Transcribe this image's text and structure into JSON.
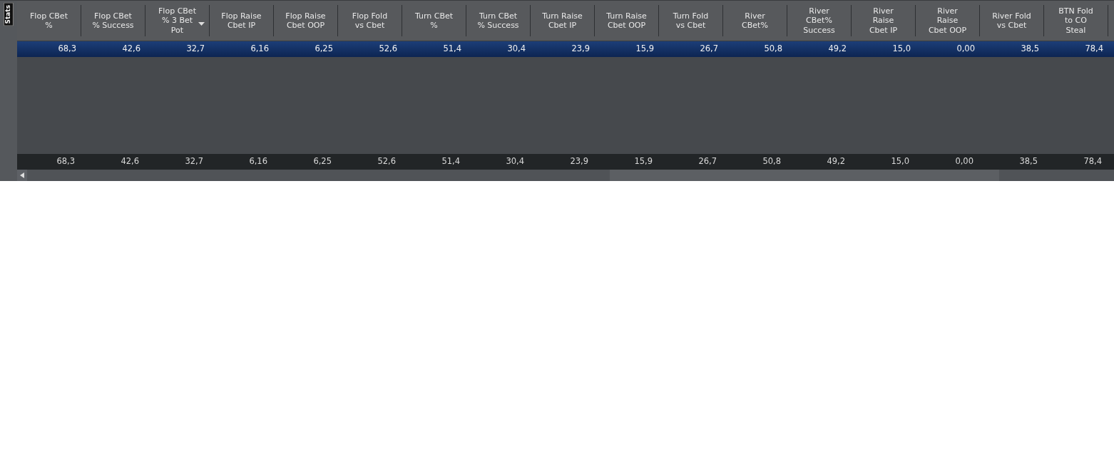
{
  "side_tab": {
    "label": "Stats"
  },
  "columns": [
    {
      "label": "Flop CBet\n%",
      "sorted": false
    },
    {
      "label": "Flop CBet\n% Success",
      "sorted": false
    },
    {
      "label": "Flop CBet\n% 3 Bet\nPot",
      "sorted": true
    },
    {
      "label": "Flop Raise\nCbet IP",
      "sorted": false
    },
    {
      "label": "Flop Raise\nCbet OOP",
      "sorted": false
    },
    {
      "label": "Flop Fold\nvs Cbet",
      "sorted": false
    },
    {
      "label": "Turn CBet\n%",
      "sorted": false
    },
    {
      "label": "Turn CBet\n% Success",
      "sorted": false
    },
    {
      "label": "Turn Raise\nCbet IP",
      "sorted": false
    },
    {
      "label": "Turn Raise\nCbet OOP",
      "sorted": false
    },
    {
      "label": "Turn Fold\nvs Cbet",
      "sorted": false
    },
    {
      "label": "River\nCBet%",
      "sorted": false
    },
    {
      "label": "River\nCBet%\nSuccess",
      "sorted": false
    },
    {
      "label": "River\nRaise\nCbet IP",
      "sorted": false
    },
    {
      "label": "River\nRaise\nCbet OOP",
      "sorted": false
    },
    {
      "label": "River Fold\nvs Cbet",
      "sorted": false
    },
    {
      "label": "BTN Fold\nto CO\nSteal",
      "sorted": false
    }
  ],
  "rows": [
    {
      "selected": true,
      "cells": [
        "68,3",
        "42,6",
        "32,7",
        "6,16",
        "6,25",
        "52,6",
        "51,4",
        "30,4",
        "23,9",
        "15,9",
        "26,7",
        "50,8",
        "49,2",
        "15,0",
        "0,00",
        "38,5",
        "78,4"
      ]
    }
  ],
  "totals": [
    "68,3",
    "42,6",
    "32,7",
    "6,16",
    "6,25",
    "52,6",
    "51,4",
    "30,4",
    "23,9",
    "15,9",
    "26,7",
    "50,8",
    "49,2",
    "15,0",
    "0,00",
    "38,5",
    "78,4"
  ]
}
